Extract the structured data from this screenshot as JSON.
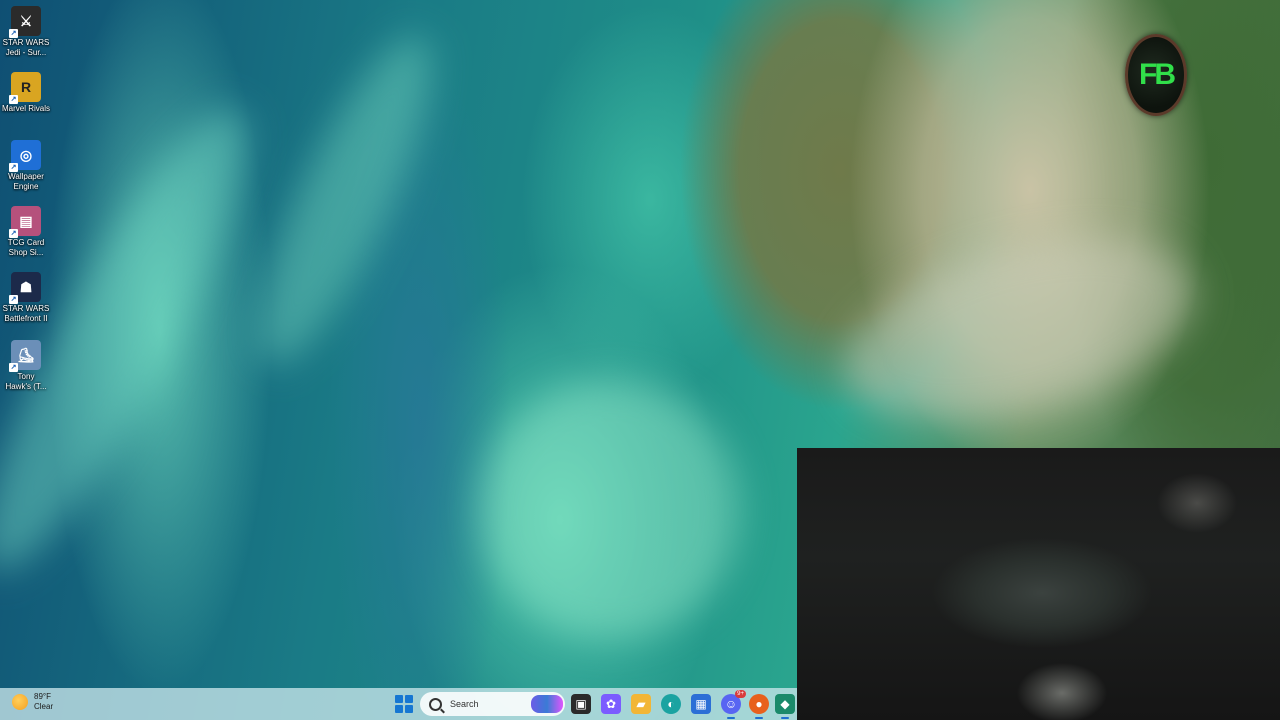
{
  "desktop": {
    "icons": [
      {
        "id": "star-wars-jedi",
        "line1": "STAR WARS",
        "line2": "Jedi - Sur...",
        "icon": "jedi-icon",
        "color": "#2b2b2b",
        "glyph": "⚔"
      },
      {
        "id": "marvel-rivals",
        "line1": "Marvel Rivals",
        "line2": "",
        "icon": "marvel-rivals-icon",
        "color": "#d9a521",
        "glyph": "R"
      },
      {
        "id": "wallpaper-engine",
        "line1": "Wallpaper",
        "line2": "Engine",
        "icon": "wallpaper-engine-icon",
        "color": "#1f6fd6",
        "glyph": "◎"
      },
      {
        "id": "tcg-card-shop",
        "line1": "TCG Card",
        "line2": "Shop Si...",
        "icon": "tcg-card-shop-icon",
        "color": "#b5517c",
        "glyph": "▤"
      },
      {
        "id": "star-wars-battlefront",
        "line1": "STAR WARS",
        "line2": "Battlefront II",
        "icon": "battlefront-icon",
        "color": "#1c2a4a",
        "glyph": "☗"
      },
      {
        "id": "tony-hawk",
        "line1": "Tony",
        "line2": "Hawk's (T...",
        "icon": "tony-hawk-icon",
        "color": "#6b8fb8",
        "glyph": "⛸"
      }
    ]
  },
  "overlay": {
    "logo_text": "FB",
    "logo_color": "#31e04a"
  },
  "taskbar": {
    "weather": {
      "temperature": "89°F",
      "condition": "Clear",
      "icon": "sun-icon"
    },
    "search": {
      "placeholder": "Search"
    },
    "apps": [
      {
        "id": "task-view",
        "icon": "task-view-icon",
        "glyph": "▣",
        "color": "#2a2a2a",
        "badge": ""
      },
      {
        "id": "copilot",
        "icon": "copilot-icon",
        "glyph": "✿",
        "color": "#7b5cff",
        "badge": ""
      },
      {
        "id": "file-explorer",
        "icon": "folder-icon",
        "glyph": "▰",
        "color": "#f2b636",
        "badge": ""
      },
      {
        "id": "edge",
        "icon": "edge-icon",
        "glyph": "◐",
        "color": "#1aa3a1",
        "badge": ""
      },
      {
        "id": "microsoft-store",
        "icon": "store-icon",
        "glyph": "▦",
        "color": "#2b6fd6",
        "badge": ""
      },
      {
        "id": "discord",
        "icon": "discord-icon",
        "glyph": "☺",
        "color": "#5865f2",
        "badge": "9+"
      },
      {
        "id": "firefox",
        "icon": "firefox-icon",
        "glyph": "●",
        "color": "#e8611c",
        "badge": ""
      },
      {
        "id": "app-extra",
        "icon": "app-icon",
        "glyph": "◆",
        "color": "#1a8a6a",
        "badge": ""
      }
    ]
  }
}
